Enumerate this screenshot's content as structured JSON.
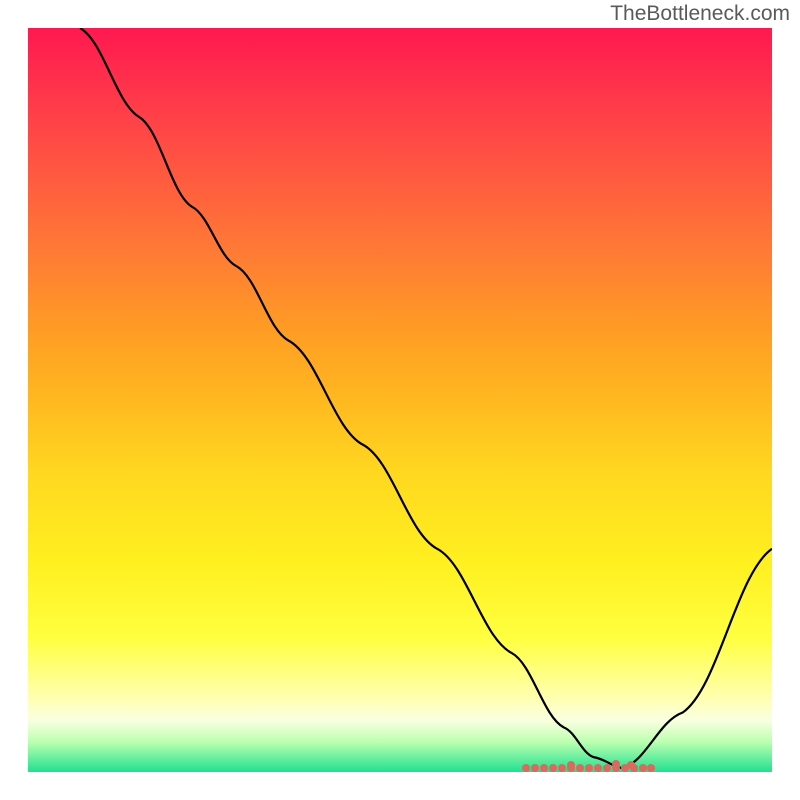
{
  "watermark": "TheBottleneck.com",
  "chart_data": {
    "type": "line",
    "title": "",
    "xlabel": "",
    "ylabel": "",
    "xlim": [
      0,
      100
    ],
    "ylim": [
      0,
      100
    ],
    "series": [
      {
        "name": "curve",
        "x": [
          7,
          15,
          22,
          28,
          35,
          45,
          55,
          65,
          72,
          76,
          80,
          88,
          100
        ],
        "y": [
          100,
          88,
          76,
          68,
          58,
          44,
          30,
          16,
          6,
          2,
          0.5,
          8,
          30
        ]
      }
    ],
    "optimal_region": {
      "start": 67,
      "end": 84
    },
    "gradient": {
      "top": "#ff1850",
      "mid": "#ffd820",
      "bottom": "#20e090"
    }
  }
}
